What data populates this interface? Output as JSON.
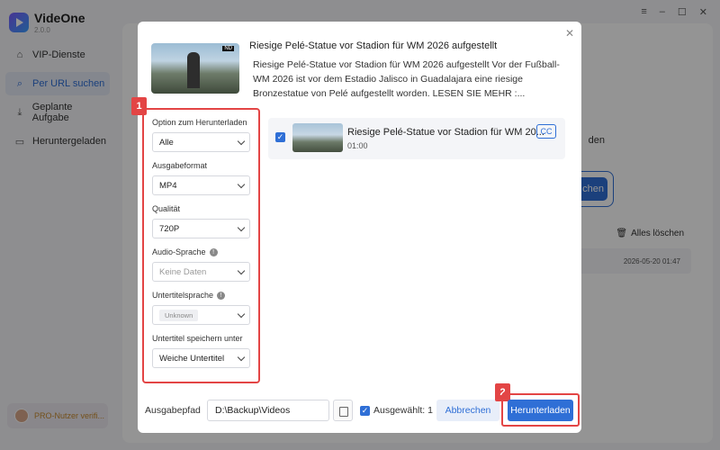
{
  "app": {
    "name": "VideOne",
    "version": "2.0.0",
    "window_controls": {
      "menu": "≡",
      "minimize": "–",
      "maximize": "☐",
      "close": "✕"
    }
  },
  "sidebar": {
    "items": [
      {
        "label": "VIP-Dienste",
        "icon": "home-icon"
      },
      {
        "label": "Per URL suchen",
        "icon": "search-icon"
      },
      {
        "label": "Geplante Aufgabe",
        "icon": "download-icon"
      },
      {
        "label": "Heruntergeladen",
        "icon": "folder-icon"
      }
    ],
    "pro_label": "PRO-Nutzer verifi..."
  },
  "background": {
    "loeschen_text": "den",
    "button_text": "chen",
    "alles_loeschen": "Alles löschen",
    "row_timestamp": "2026-05-20 01:47"
  },
  "dialog": {
    "video_title": "Riesige Pelé-Statue vor Stadion für WM 2026 aufgestellt",
    "video_description": "Riesige Pelé-Statue vor Stadion für WM 2026 aufgestellt Vor der Fußball-WM 2026 ist vor dem Estadio Jalisco in Guadalajara eine riesige Bronzestatue von Pelé aufgestellt worden. LESEN SIE MEHR :...",
    "badge_1": "1",
    "badge_2": "2",
    "options": {
      "download_option_label": "Option zum Herunterladen",
      "download_option_value": "Alle",
      "format_label": "Ausgabeformat",
      "format_value": "MP4",
      "quality_label": "Qualität",
      "quality_value": "720P",
      "audio_label": "Audio-Sprache",
      "audio_value": "Keine Daten",
      "subtitle_lang_label": "Untertitelsprache",
      "subtitle_lang_value": "Unknown",
      "subtitle_save_label": "Untertitel speichern unter",
      "subtitle_save_value": "Weiche Untertitel"
    },
    "item": {
      "title": "Riesige Pelé-Statue vor Stadion für WM 20...",
      "duration": "01:00",
      "cc": "CC"
    },
    "footer": {
      "output_label": "Ausgabepfad",
      "output_path": "D:\\Backup\\Videos",
      "selected_label": "Ausgewählt: 1",
      "cancel": "Abbrechen",
      "download": "Herunterladen"
    }
  },
  "colors": {
    "accent": "#2f6fd6",
    "highlight": "#e34545"
  }
}
